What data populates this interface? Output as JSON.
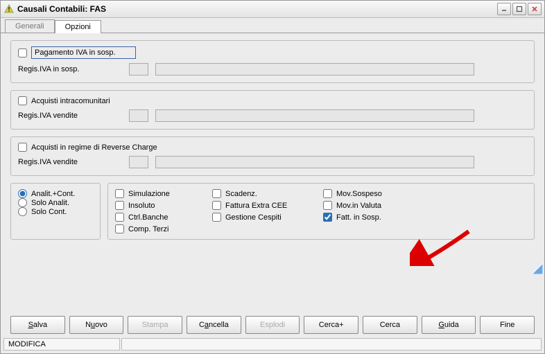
{
  "window": {
    "title": "Causali Contabili: FAS"
  },
  "tabs": {
    "generali": "Generali",
    "opzioni": "Opzioni"
  },
  "group1": {
    "check_label": "Pagamento IVA in sosp.",
    "field_label": "Regis.IVA in sosp.",
    "small_val": "",
    "long_val": ""
  },
  "group2": {
    "check_label": "Acquisti intracomunitari",
    "field_label": "Regis.IVA vendite",
    "small_val": "",
    "long_val": ""
  },
  "group3": {
    "check_label": "Acquisti in regime di Reverse Charge",
    "field_label": "Regis.IVA vendite",
    "small_val": "",
    "long_val": ""
  },
  "radios": {
    "r1": "Analit.+Cont.",
    "r2": "Solo Analit.",
    "r3": "Solo Cont."
  },
  "checks": {
    "c1": {
      "simulazione": "Simulazione",
      "insoluto": "Insoluto",
      "ctrl_banche": "Ctrl.Banche",
      "comp_terzi": "Comp. Terzi"
    },
    "c2": {
      "scadenz": "Scadenz.",
      "fattura_extra_cee": "Fattura Extra CEE",
      "gestione_cespiti": "Gestione Cespiti"
    },
    "c3": {
      "mov_sospeso": "Mov.Sospeso",
      "mov_in_valuta": "Mov.in Valuta",
      "fatt_in_sosp": "Fatt. in Sosp."
    }
  },
  "buttons": {
    "salva": "Salva",
    "nuovo": "Nuovo",
    "stampa": "Stampa",
    "cancella": "Cancella",
    "esplodi": "Esplodi",
    "cerca_plus": "Cerca+",
    "cerca": "Cerca",
    "guida": "Guida",
    "fine": "Fine"
  },
  "status": {
    "mode": "MODIFICA",
    "rest": ""
  }
}
